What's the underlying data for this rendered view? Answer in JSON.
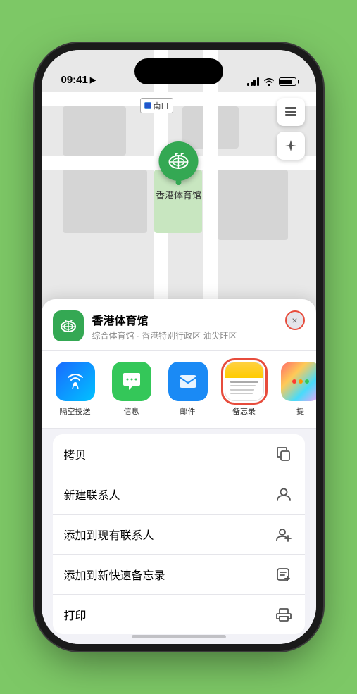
{
  "status_bar": {
    "time": "09:41",
    "location_arrow": "▶"
  },
  "map": {
    "label_text": "南口",
    "stadium_name": "香港体育馆",
    "pin_label": "香港体育馆"
  },
  "location_header": {
    "name": "香港体育馆",
    "subtitle": "综合体育馆 · 香港特别行政区 油尖旺区",
    "close_label": "×"
  },
  "share_apps": [
    {
      "id": "airdrop",
      "label": "隔空投送",
      "type": "airdrop"
    },
    {
      "id": "messages",
      "label": "信息",
      "type": "messages"
    },
    {
      "id": "mail",
      "label": "邮件",
      "type": "mail"
    },
    {
      "id": "notes",
      "label": "备忘录",
      "type": "notes",
      "selected": true
    },
    {
      "id": "more",
      "label": "提",
      "type": "more"
    }
  ],
  "actions": [
    {
      "id": "copy",
      "label": "拷贝",
      "icon": "copy"
    },
    {
      "id": "new-contact",
      "label": "新建联系人",
      "icon": "person-add"
    },
    {
      "id": "add-existing",
      "label": "添加到现有联系人",
      "icon": "person-circle-add"
    },
    {
      "id": "add-quick-note",
      "label": "添加到新快速备忘录",
      "icon": "quick-note"
    },
    {
      "id": "print",
      "label": "打印",
      "icon": "printer"
    }
  ]
}
